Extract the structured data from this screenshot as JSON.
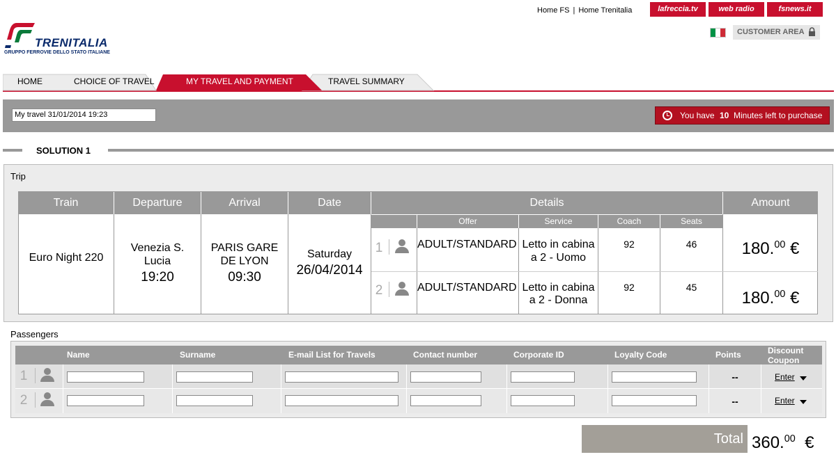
{
  "header": {
    "links": [
      "Home FS",
      "Home Trenitalia"
    ],
    "link_separator": "|",
    "media_buttons": [
      "lafreccia.tv",
      "web radio",
      "fsnews.it"
    ],
    "customer_area": "CUSTOMER AREA",
    "logo_name": "TRENITALIA",
    "logo_sub": "GRUPPO FERROVIE DELLO STATO ITALIANE"
  },
  "tabs": [
    {
      "label": "HOME",
      "active": false
    },
    {
      "label": "CHOICE OF TRAVEL",
      "active": false
    },
    {
      "label": "MY TRAVEL AND PAYMENT",
      "active": true
    },
    {
      "label": "TRAVEL SUMMARY",
      "active": false
    }
  ],
  "travel_bar": {
    "my_travel": "My travel 31/01/2014 19:23",
    "timer_prefix": "You have",
    "timer_minutes": "10",
    "timer_suffix": "Minutes left to purchase"
  },
  "solution": {
    "title": "SOLUTION 1",
    "trip_label": "Trip",
    "headers": {
      "train": "Train",
      "departure": "Departure",
      "arrival": "Arrival",
      "date": "Date",
      "details": "Details",
      "amount": "Amount",
      "offer": "Offer",
      "service": "Service",
      "coach": "Coach",
      "seats": "Seats"
    },
    "train": "Euro Night  220",
    "departure_station_1": "Venezia S.",
    "departure_station_2": "Lucia",
    "departure_time": "19:20",
    "arrival_station_1": "PARIS GARE",
    "arrival_station_2": "DE LYON",
    "arrival_time": "09:30",
    "date_day": "Saturday",
    "date": "26/04/2014",
    "details": [
      {
        "num": "1",
        "offer": "ADULT/STANDARD",
        "service_1": "Letto in cabina",
        "service_2": "a 2 - Uomo",
        "coach": "92",
        "seats": "46",
        "amount_int": "180.",
        "amount_dec": "00",
        "currency": "€"
      },
      {
        "num": "2",
        "offer": "ADULT/STANDARD",
        "service_1": "Letto in cabina",
        "service_2": "a 2 - Donna",
        "coach": "92",
        "seats": "45",
        "amount_int": "180.",
        "amount_dec": "00",
        "currency": "€"
      }
    ]
  },
  "passengers": {
    "label": "Passengers",
    "headers": {
      "name": "Name",
      "surname": "Surname",
      "email": "E-mail List for Travels",
      "contact": "Contact number",
      "corporate": "Corporate ID",
      "loyalty": "Loyalty Code",
      "points": "Points",
      "discount_1": "Discount",
      "discount_2": "Coupon"
    },
    "rows": [
      {
        "num": "1",
        "points": "--",
        "enter": "Enter"
      },
      {
        "num": "2",
        "points": "--",
        "enter": "Enter"
      }
    ]
  },
  "total": {
    "label": "Total",
    "amount_int": "360.",
    "amount_dec": "00",
    "currency": "€"
  },
  "colors": {
    "brand_red": "#c8102e",
    "header_gray": "#999999",
    "panel_bg": "#ececec"
  }
}
